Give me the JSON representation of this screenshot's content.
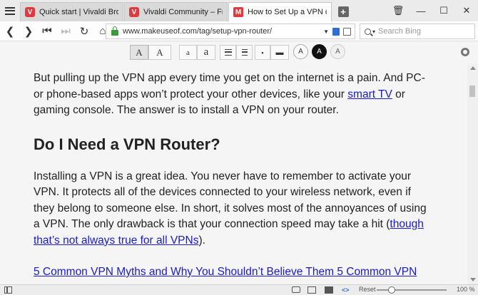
{
  "browser": {
    "tabs": [
      {
        "title": "Quick start | Vivaldi Browser",
        "favicon": "V",
        "active": false
      },
      {
        "title": "Vivaldi Community – Free we",
        "favicon": "V",
        "active": false
      },
      {
        "title": "How to Set Up a VPN on You",
        "favicon": "M",
        "active": true
      }
    ],
    "url": "www.makeuseof.com/tag/setup-vpn-router/",
    "search_placeholder": "Search Bing"
  },
  "reader": {
    "font_serif": "A",
    "font_sans": "A",
    "size_small": "a",
    "size_large": "a",
    "theme_light": "A",
    "theme_dark": "A",
    "theme_gray": "A"
  },
  "article": {
    "p1_text": "But pulling up the VPN app every time you get on the internet is a pain. And PC- or phone-based apps won’t protect your other devices, like your ",
    "p1_link": "smart TV",
    "p1_tail": " or gaming console. The answer is to install a VPN on your router.",
    "heading": "Do I Need a VPN Router?",
    "p2_text": "Installing a VPN is a great idea. You never have to remember to activate your VPN. It protects all of the devices connected to your wireless network, even if they belong to someone else. In short, it solves most of the annoyances of using a VPN. The only drawback is that your connection speed may take a hit (",
    "p2_link": "though that’s not always true for all VPNs",
    "p2_tail": ").",
    "cut_link": "5 Common VPN Myths and Why You Shouldn’t Believe Them 5 Common VPN"
  },
  "status": {
    "reset_label": "Reset",
    "zoom": "100 %"
  },
  "colors": {
    "accent_red": "#e03a3e",
    "link_blue": "#1a1acb",
    "lock_green": "#3a9b3a"
  }
}
